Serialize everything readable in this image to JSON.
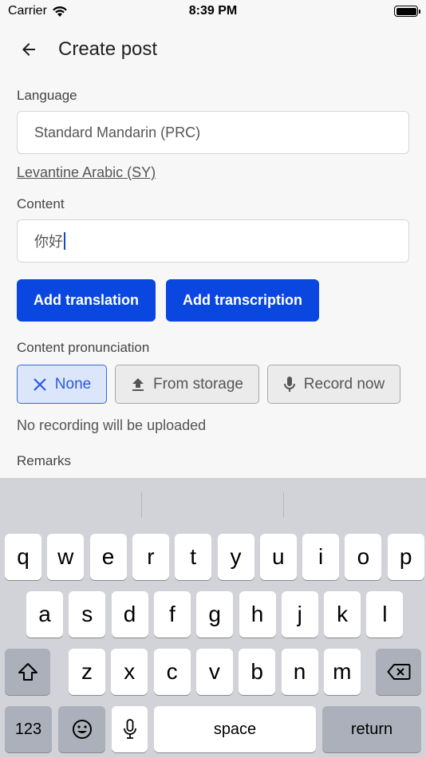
{
  "status_bar": {
    "carrier": "Carrier",
    "time": "8:39 PM",
    "battery_level": 1.0
  },
  "app_bar": {
    "title": "Create post"
  },
  "form": {
    "language_label": "Language",
    "language_value": "Standard Mandarin (PRC)",
    "secondary_language_link": "Levantine Arabic (SY)",
    "content_label": "Content",
    "content_value": "你好",
    "add_translation": "Add translation",
    "add_transcription": "Add transcription",
    "pronunciation_label": "Content pronunciation",
    "pronunciation_options": {
      "none": "None",
      "from_storage": "From storage",
      "record_now": "Record now"
    },
    "pronunciation_selected": "None",
    "helper_text": "No recording will be uploaded",
    "remarks_label": "Remarks"
  },
  "keyboard": {
    "row1": [
      "q",
      "w",
      "e",
      "r",
      "t",
      "y",
      "u",
      "i",
      "o",
      "p"
    ],
    "row2": [
      "a",
      "s",
      "d",
      "f",
      "g",
      "h",
      "j",
      "k",
      "l"
    ],
    "row3": [
      "z",
      "x",
      "c",
      "v",
      "b",
      "n",
      "m"
    ],
    "numbers_key": "123",
    "space_key": "space",
    "return_key": "return"
  },
  "colors": {
    "primary": "#0a47e0",
    "selected_bg": "#dce6fb",
    "keyboard_bg": "#d1d3d9"
  }
}
